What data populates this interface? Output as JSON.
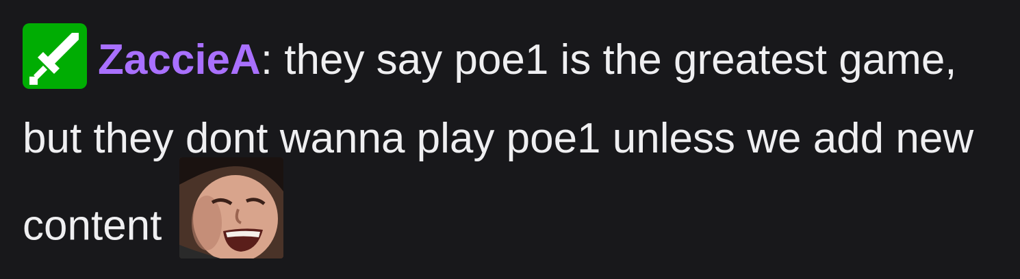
{
  "chat_message": {
    "badge": {
      "icon": "sword-icon",
      "color": "#00ad03"
    },
    "username": "ZaccieA",
    "username_color": "#a970ff",
    "separator": ":",
    "text": " they say poe1 is the greatest game, but they dont wanna play poe1 unless we add new content ",
    "emote": {
      "icon": "laughing-face-emote"
    }
  }
}
